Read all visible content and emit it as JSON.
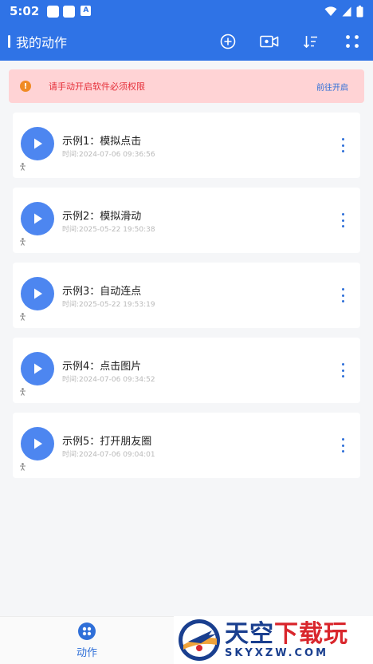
{
  "status_bar": {
    "time": "5:02",
    "badge": "A"
  },
  "app_bar": {
    "title": "我的动作",
    "actions": [
      "add-circle-icon",
      "video-record-icon",
      "sort-icon",
      "expand-icon"
    ]
  },
  "notice": {
    "text": "请手动开启软件必须权限",
    "link": "前往开启",
    "icon": "!"
  },
  "actions_list": [
    {
      "title": "示例1：模拟点击",
      "time": "时间:2024-07-06 09:36:56"
    },
    {
      "title": "示例2：模拟滑动",
      "time": "时间:2025-05-22 19:50:38"
    },
    {
      "title": "示例3：自动连点",
      "time": "时间:2025-05-22 19:53:19"
    },
    {
      "title": "示例4：点击图片",
      "time": "时间:2024-07-06 09:34:52"
    },
    {
      "title": "示例5：打开朋友圈",
      "time": "时间:2024-07-06 09:04:01"
    }
  ],
  "bottom_nav": {
    "label": "动作"
  },
  "watermark": {
    "cn_a": "天空",
    "cn_b": "下载玩",
    "en": "SKYXZW.COM"
  },
  "colors": {
    "primary": "#2f73e6",
    "notice_bg": "#ffd3d5",
    "notice_text": "#e5303a",
    "play": "#4d86f0"
  }
}
